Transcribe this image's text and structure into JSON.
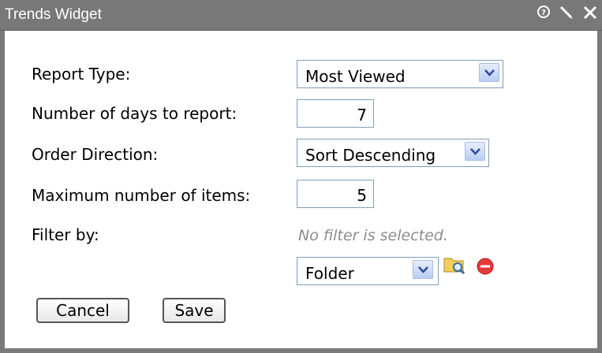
{
  "window": {
    "title": "Trends Widget",
    "controls": {
      "help_icon": "help-icon",
      "edit_icon": "pencil-icon",
      "close_icon": "close-icon"
    }
  },
  "form": {
    "report_type": {
      "label": "Report Type:",
      "value": "Most Viewed"
    },
    "days": {
      "label": "Number of days to report:",
      "value": "7"
    },
    "order": {
      "label": "Order Direction:",
      "value": "Sort Descending"
    },
    "max_items": {
      "label": "Maximum number of items:",
      "value": "5"
    },
    "filter": {
      "label": "Filter by:",
      "status": "No filter is selected.",
      "type_value": "Folder"
    }
  },
  "buttons": {
    "cancel": "Cancel",
    "save": "Save"
  },
  "colors": {
    "titlebar": "#787878",
    "field_border": "#7f9db9",
    "hint_text": "#8c8c8c",
    "remove_red": "#e53b3b",
    "folder_yellow": "#f1cf5a"
  }
}
